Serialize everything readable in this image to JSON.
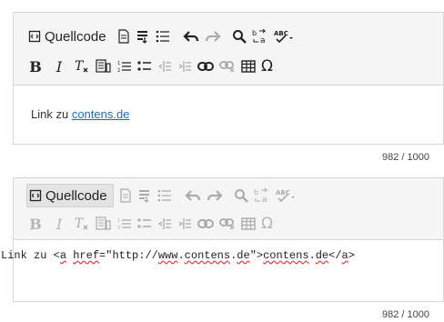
{
  "editor1": {
    "toolbar": {
      "source_label": "Quellcode",
      "bold_label": "B",
      "italic_label": "I",
      "special_char_label": "Ω"
    },
    "content": {
      "prefix": "Link zu ",
      "link_text": "contens.de"
    },
    "counter": "982 / 1000"
  },
  "editor2": {
    "toolbar": {
      "source_label": "Quellcode",
      "bold_label": "B",
      "italic_label": "I",
      "special_char_label": "Ω"
    },
    "source": {
      "part1": "Link zu <",
      "tag_a": "a",
      "part2": " ",
      "attr_href": "href",
      "part3": "=\"",
      "url_part1": "http://",
      "url_www": "www",
      "url_dot1": ".",
      "url_contens": "contens",
      "url_dot2": ".",
      "url_de": "de",
      "part4": "\">",
      "link_contens": "contens",
      "link_dot": ".",
      "link_de": "de",
      "part5": "</",
      "close_a": "a",
      "part6": ">"
    },
    "counter": "982 / 1000"
  },
  "icons": [
    "source-icon",
    "document-icon",
    "paste-icon",
    "bullet-list-icon",
    "undo-icon",
    "redo-icon",
    "search-icon",
    "replace-icon",
    "spellcheck-icon",
    "remove-format-icon",
    "paste-text-icon",
    "numbered-list-icon",
    "bulleted-list-icon",
    "outdent-icon",
    "indent-icon",
    "link-icon",
    "unlink-icon",
    "table-icon",
    "special-char-icon"
  ]
}
